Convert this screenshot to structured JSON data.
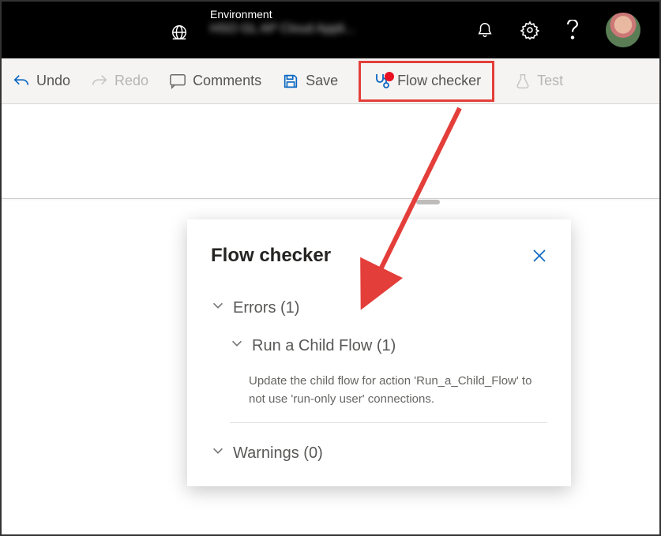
{
  "header": {
    "env_label": "Environment",
    "env_value": "HSO GL AP Cloud Appli..."
  },
  "toolbar": {
    "undo": "Undo",
    "redo": "Redo",
    "comments": "Comments",
    "save": "Save",
    "flow_checker": "Flow checker",
    "test": "Test"
  },
  "panel": {
    "title": "Flow checker",
    "errors_label": "Errors (1)",
    "child_flow_label": "Run a Child Flow (1)",
    "error_text": "Update the child flow for action 'Run_a_Child_Flow' to not use 'run-only user' connections.",
    "warnings_label": "Warnings (0)"
  }
}
